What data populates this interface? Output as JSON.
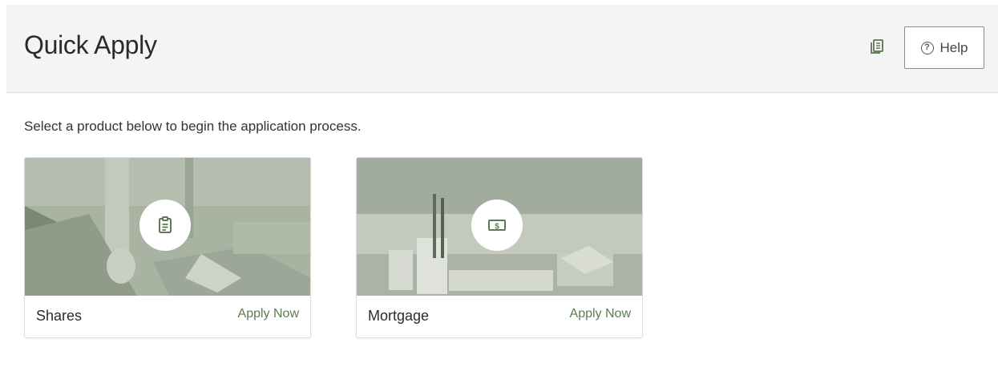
{
  "header": {
    "title": "Quick Apply",
    "docs_icon": "document-list-icon",
    "help_label": "Help",
    "help_icon": "question-circle-icon"
  },
  "intro": "Select a product below to begin the application process.",
  "accent_color": "#5e7a52",
  "products": [
    {
      "name": "Shares",
      "action": "Apply Now",
      "icon": "clipboard-icon"
    },
    {
      "name": "Mortgage",
      "action": "Apply Now",
      "icon": "dollar-bill-icon"
    }
  ]
}
